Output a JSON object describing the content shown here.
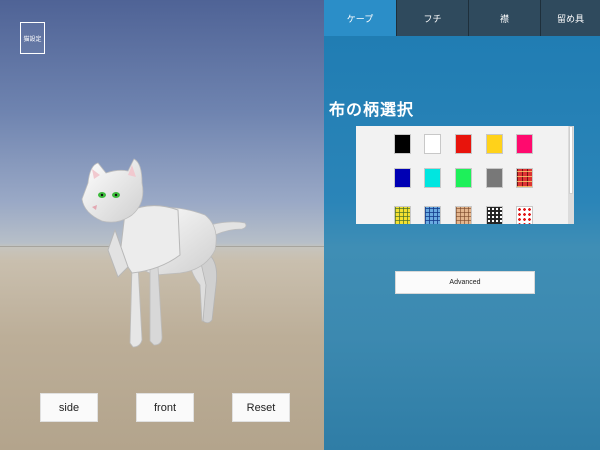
{
  "viewport": {
    "settings_label": "猫設定",
    "buttons": {
      "side": "side",
      "front": "front",
      "reset": "Reset"
    }
  },
  "panel": {
    "tabs": [
      {
        "label": "ケープ",
        "active": true
      },
      {
        "label": "フチ",
        "active": false
      },
      {
        "label": "襟",
        "active": false
      },
      {
        "label": "留め具",
        "active": false
      }
    ],
    "title": "布の柄選択",
    "swatches": [
      {
        "kind": "color",
        "color": "#000000",
        "icon": "black-swatch"
      },
      {
        "kind": "color",
        "color": "#ffffff",
        "icon": "white-swatch"
      },
      {
        "kind": "color",
        "color": "#e8140c",
        "icon": "red-swatch"
      },
      {
        "kind": "color",
        "color": "#ffd21a",
        "icon": "yellow-swatch"
      },
      {
        "kind": "color",
        "color": "#ff0a6e",
        "icon": "pink-swatch"
      },
      {
        "kind": "color",
        "color": "#0000b4",
        "icon": "navy-swatch"
      },
      {
        "kind": "color",
        "color": "#00e6e0",
        "icon": "cyan-swatch"
      },
      {
        "kind": "color",
        "color": "#1ef05a",
        "icon": "green-swatch"
      },
      {
        "kind": "color",
        "color": "#787878",
        "icon": "gray-swatch"
      },
      {
        "kind": "pattern",
        "pattern": "pat-red-plaid",
        "icon": "red-plaid-swatch"
      },
      {
        "kind": "pattern",
        "pattern": "pat-yellow",
        "icon": "yellow-check-swatch"
      },
      {
        "kind": "pattern",
        "pattern": "pat-blue",
        "icon": "blue-check-swatch"
      },
      {
        "kind": "pattern",
        "pattern": "pat-brown",
        "icon": "brown-check-swatch"
      },
      {
        "kind": "pattern",
        "pattern": "pat-dots",
        "icon": "black-polka-dot-swatch"
      },
      {
        "kind": "pattern",
        "pattern": "pat-red-dots",
        "icon": "red-polka-dot-swatch"
      }
    ],
    "advanced_label": "Advanced"
  },
  "colors": {
    "panel_blue": "#1e7bb2",
    "tab_active": "#2b8ec8",
    "tab_inactive": "#2f4a5d"
  }
}
